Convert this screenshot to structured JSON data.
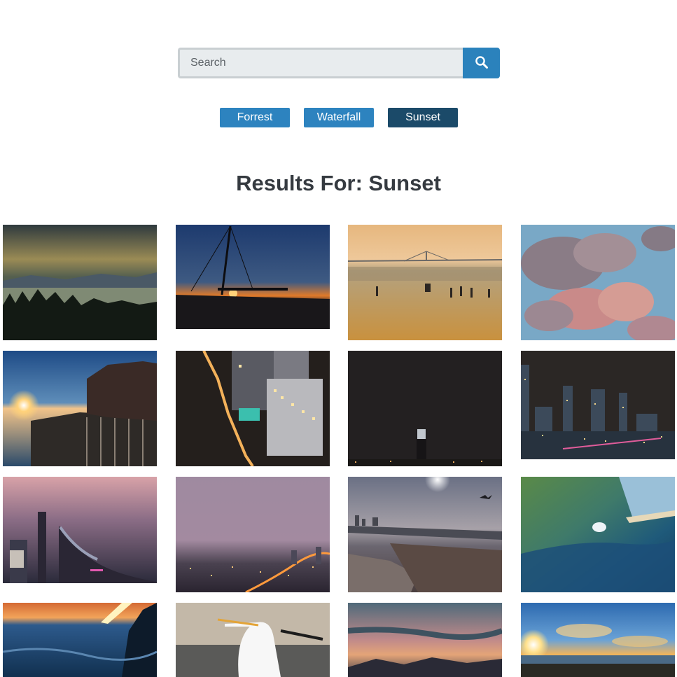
{
  "search": {
    "placeholder": "Search",
    "button_icon": "search-icon"
  },
  "filters": [
    {
      "label": "Forrest",
      "active": false
    },
    {
      "label": "Waterfall",
      "active": false
    },
    {
      "label": "Sunset",
      "active": true
    }
  ],
  "results": {
    "title": "Results For: Sunset",
    "images": [
      {
        "subject": "dusk-lake-forest"
      },
      {
        "subject": "sailboat-mast-sunset"
      },
      {
        "subject": "beach-bridge-golden"
      },
      {
        "subject": "pink-clouds-blue-sky"
      },
      {
        "subject": "sunburst-harbor-fence"
      },
      {
        "subject": "night-city-aerial-street"
      },
      {
        "subject": "dark-tower-lit-top"
      },
      {
        "subject": "night-skyline-skyscrapers"
      },
      {
        "subject": "purple-dusk-city-river"
      },
      {
        "subject": "hazy-city-lights-dusk"
      },
      {
        "subject": "beach-boardwalk-bird"
      },
      {
        "subject": "green-ocean-wave"
      },
      {
        "subject": "ocean-sunset-waves"
      },
      {
        "subject": "white-egret-flying"
      },
      {
        "subject": "sunset-clouds-mountains"
      },
      {
        "subject": "sunset-sea-clouds"
      }
    ]
  }
}
